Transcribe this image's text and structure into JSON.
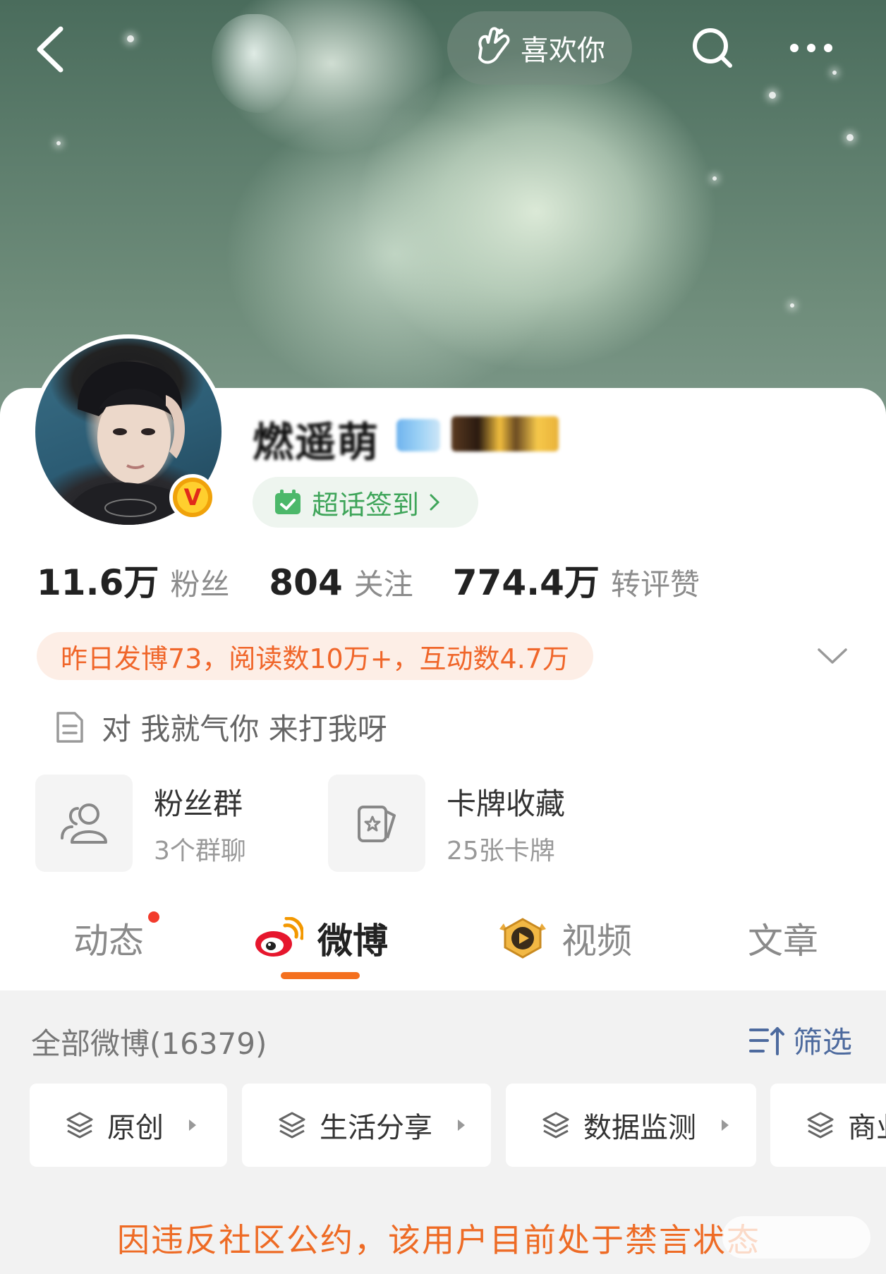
{
  "header": {
    "like_label": "喜欢你"
  },
  "profile": {
    "username": "燃遥萌",
    "super_topic_label": "超话签到"
  },
  "stats": [
    {
      "num": "11.6万",
      "label": "粉丝"
    },
    {
      "num": "804",
      "label": "关注"
    },
    {
      "num": "774.4万",
      "label": "转评赞"
    }
  ],
  "yesterday_summary": "昨日发博73，阅读数10万+，互动数4.7万",
  "bio": "对 我就气你 来打我呀",
  "tiles": [
    {
      "title": "粉丝群",
      "subtitle": "3个群聊",
      "icon": "fan-group-icon"
    },
    {
      "title": "卡牌收藏",
      "subtitle": "25张卡牌",
      "icon": "card-collection-icon"
    }
  ],
  "tabs": [
    {
      "label": "动态",
      "has_dot": true
    },
    {
      "label": "微博",
      "active": true
    },
    {
      "label": "视频"
    },
    {
      "label": "文章"
    }
  ],
  "feed": {
    "title": "全部微博(16379)",
    "filter_label": "筛选",
    "chips": [
      "原创",
      "生活分享",
      "数据监测",
      "商业"
    ]
  },
  "notice": "因违反社区公约，该用户目前处于禁言状态",
  "colors": {
    "accent_orange": "#f4701e",
    "notice_orange": "#ee6b25",
    "supertopic_green": "#3fa55a",
    "filter_blue": "#4d6a9e"
  }
}
